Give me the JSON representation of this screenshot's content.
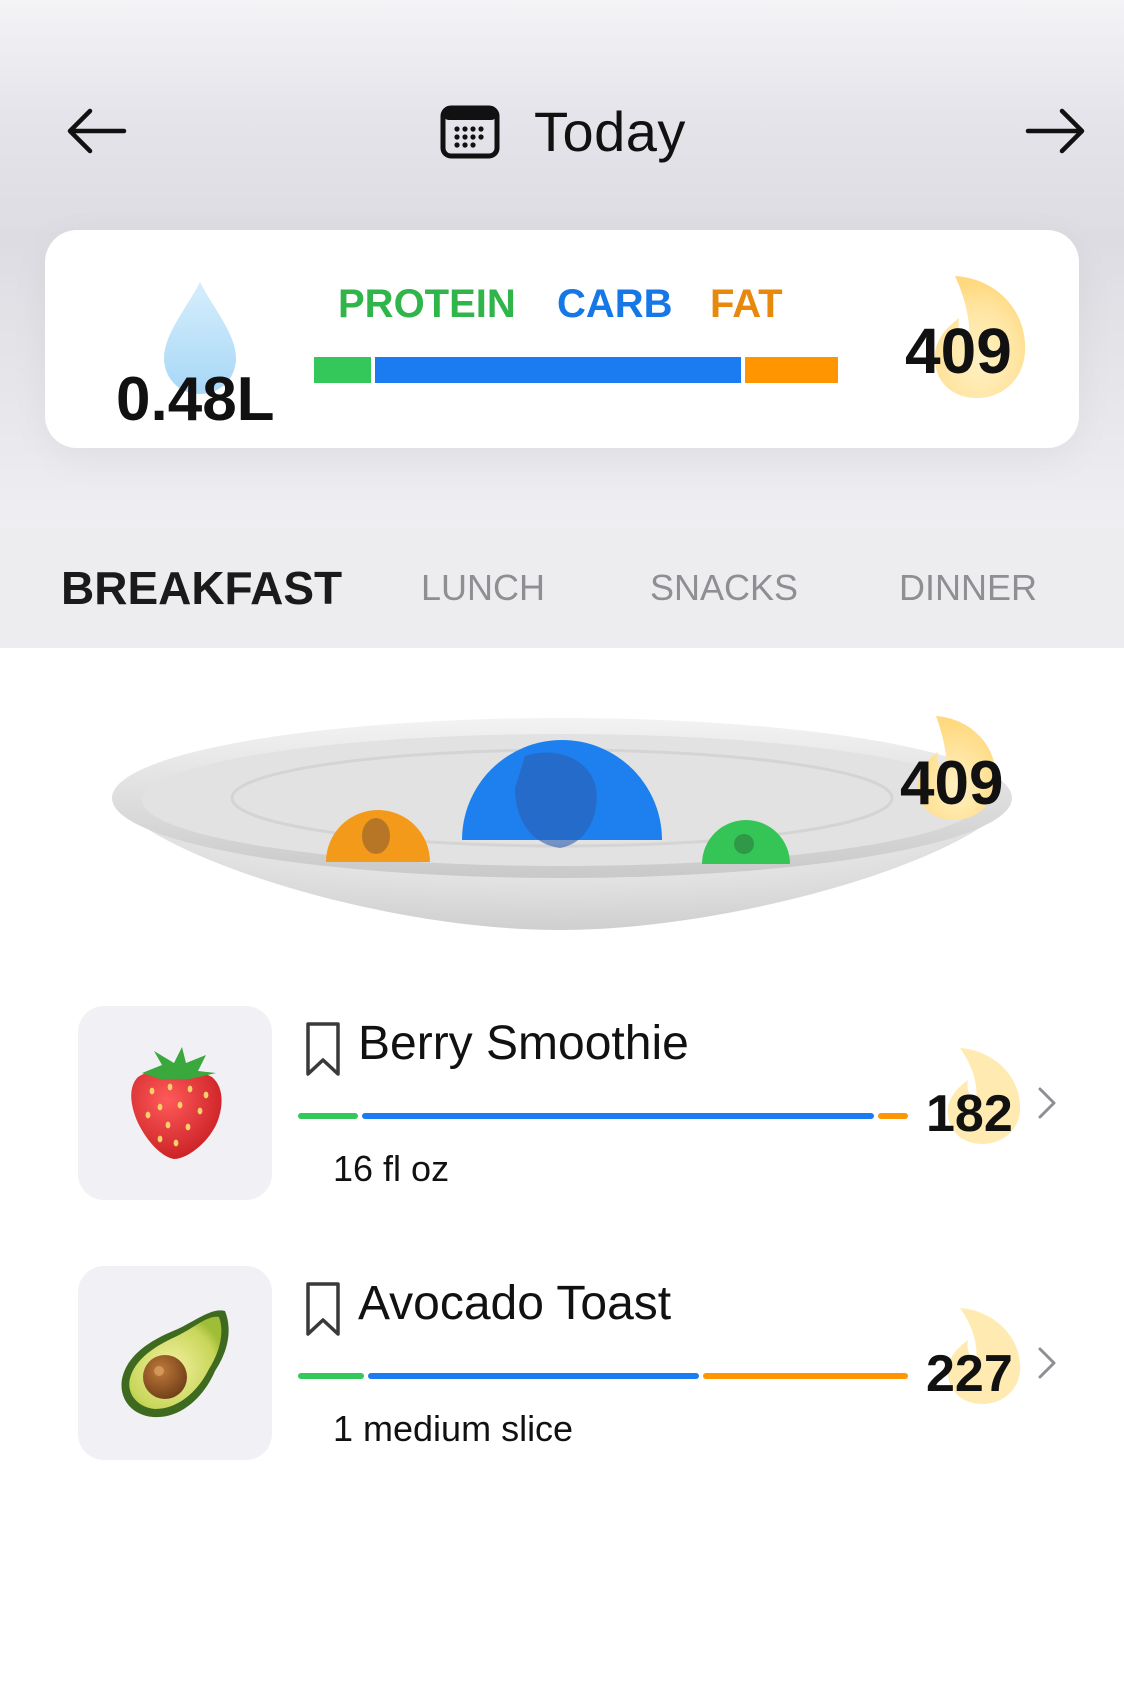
{
  "header": {
    "title": "Today",
    "back_icon": "arrow-left-icon",
    "forward_icon": "arrow-right-icon",
    "calendar_icon": "calendar-icon"
  },
  "summary": {
    "water": "0.48L",
    "calories": "409",
    "macro_labels": {
      "protein": "PROTEIN",
      "carb": "CARB",
      "fat": "FAT"
    },
    "macro_split": {
      "protein": 0.11,
      "carb": 0.71,
      "fat": 0.18
    }
  },
  "colors": {
    "protein": "#34c759",
    "carb": "#1a7cf0",
    "fat": "#ff9500",
    "protein_text": "#2fb54a",
    "carb_text": "#1677e6",
    "fat_text": "#e8890e"
  },
  "tabs": [
    {
      "label": "BREAKFAST",
      "active": true
    },
    {
      "label": "LUNCH",
      "active": false
    },
    {
      "label": "SNACKS",
      "active": false
    },
    {
      "label": "DINNER",
      "active": false
    }
  ],
  "plate": {
    "calories": "409"
  },
  "meals": [
    {
      "name": "Berry Smoothie",
      "portion": "16 fl oz",
      "calories": "182",
      "icon": "strawberry-icon",
      "macro_split": {
        "protein": 0.1,
        "carb": 0.85,
        "fat": 0.05
      }
    },
    {
      "name": "Avocado Toast",
      "portion": "1 medium slice",
      "calories": "227",
      "icon": "avocado-icon",
      "macro_split": {
        "protein": 0.11,
        "carb": 0.55,
        "fat": 0.34
      }
    }
  ]
}
